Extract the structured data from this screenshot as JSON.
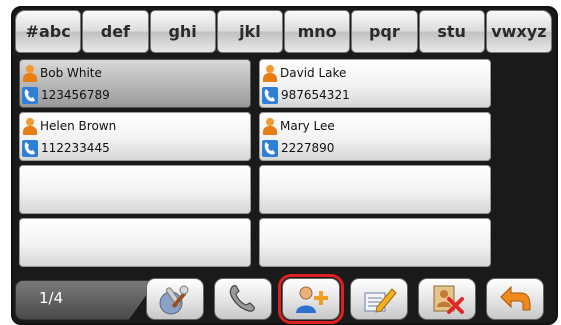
{
  "alphabet_tabs": [
    "#abc",
    "def",
    "ghi",
    "jkl",
    "mno",
    "pqr",
    "stu",
    "vwxyz"
  ],
  "contacts": [
    {
      "name": "Bob White",
      "phone": "123456789",
      "selected": true
    },
    {
      "name": "David Lake",
      "phone": "987654321",
      "selected": false
    },
    {
      "name": "Helen Brown",
      "phone": "112233445",
      "selected": false
    },
    {
      "name": "Mary Lee",
      "phone": "2227890",
      "selected": false
    }
  ],
  "pager": {
    "label": "1/4"
  },
  "toolbar": [
    {
      "name": "settings-tools-button",
      "icon": "tools-icon"
    },
    {
      "name": "call-button",
      "icon": "phone-handset-icon"
    },
    {
      "name": "add-contact-button",
      "icon": "add-contact-icon",
      "highlighted": true
    },
    {
      "name": "edit-contact-button",
      "icon": "edit-pencil-icon"
    },
    {
      "name": "delete-contact-button",
      "icon": "delete-contact-icon"
    },
    {
      "name": "back-button",
      "icon": "back-arrow-icon"
    }
  ],
  "colors": {
    "highlight": "#e02020",
    "person_icon": "#e67e14",
    "phone_icon": "#2f7fd6"
  }
}
